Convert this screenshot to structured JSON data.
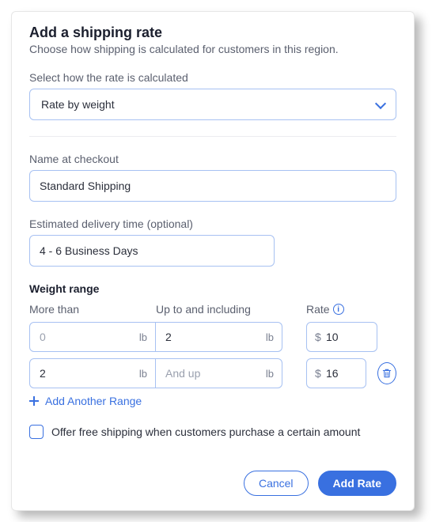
{
  "header": {
    "title": "Add a shipping rate",
    "subtitle": "Choose how shipping is calculated for customers in this region."
  },
  "calc": {
    "label": "Select how the rate is calculated",
    "value": "Rate by weight"
  },
  "name": {
    "label": "Name at checkout",
    "value": "Standard Shipping"
  },
  "eta": {
    "label": "Estimated delivery time (optional)",
    "value": "4 - 6 Business Days"
  },
  "range": {
    "heading": "Weight range",
    "cols": {
      "more": "More than",
      "upto": "Up to and including",
      "rate": "Rate"
    },
    "unit": "lb",
    "currency": "$",
    "and_up": "And up",
    "rows": [
      {
        "more": "0",
        "upto": "2",
        "rate": "10"
      },
      {
        "more": "2",
        "upto": "",
        "rate": "16"
      }
    ],
    "add_another": "Add Another Range"
  },
  "free_ship": {
    "label": "Offer free shipping when customers purchase a certain amount",
    "checked": false
  },
  "actions": {
    "cancel": "Cancel",
    "submit": "Add Rate"
  }
}
